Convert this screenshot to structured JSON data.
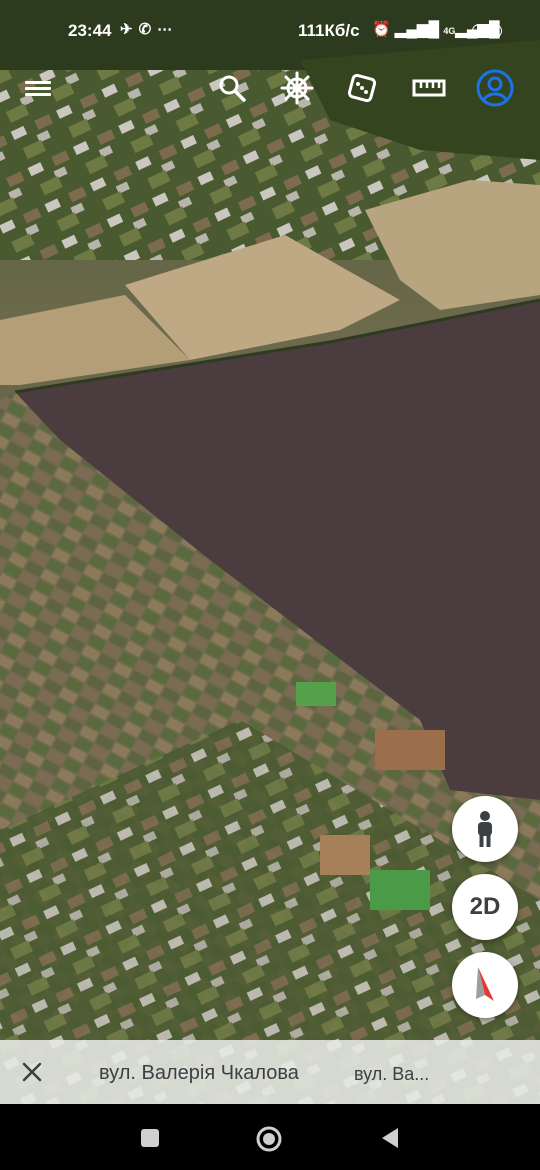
{
  "status_bar": {
    "time": "23:44",
    "speed": "111Кб/с",
    "network": "4G",
    "battery": "34"
  },
  "toolbar": {
    "menu_icon": "hamburger-menu-icon",
    "search_icon": "search-icon",
    "voyager_icon": "ship-wheel-icon",
    "feeling_lucky_icon": "dice-icon",
    "measure_icon": "ruler-icon",
    "account_icon": "account-icon",
    "accent_color": "#1a73e8"
  },
  "map_controls": {
    "pegman_icon": "pegman-icon",
    "view_mode_label": "2D",
    "compass_icon": "compass-icon"
  },
  "address_bar": {
    "close_icon": "close-icon",
    "primary_address": "вул. Валерія Чкалова",
    "secondary_address": "вул. Ва..."
  },
  "nav_bar": {
    "recent_icon": "recent-apps-icon",
    "home_icon": "home-icon",
    "back_icon": "back-icon"
  }
}
